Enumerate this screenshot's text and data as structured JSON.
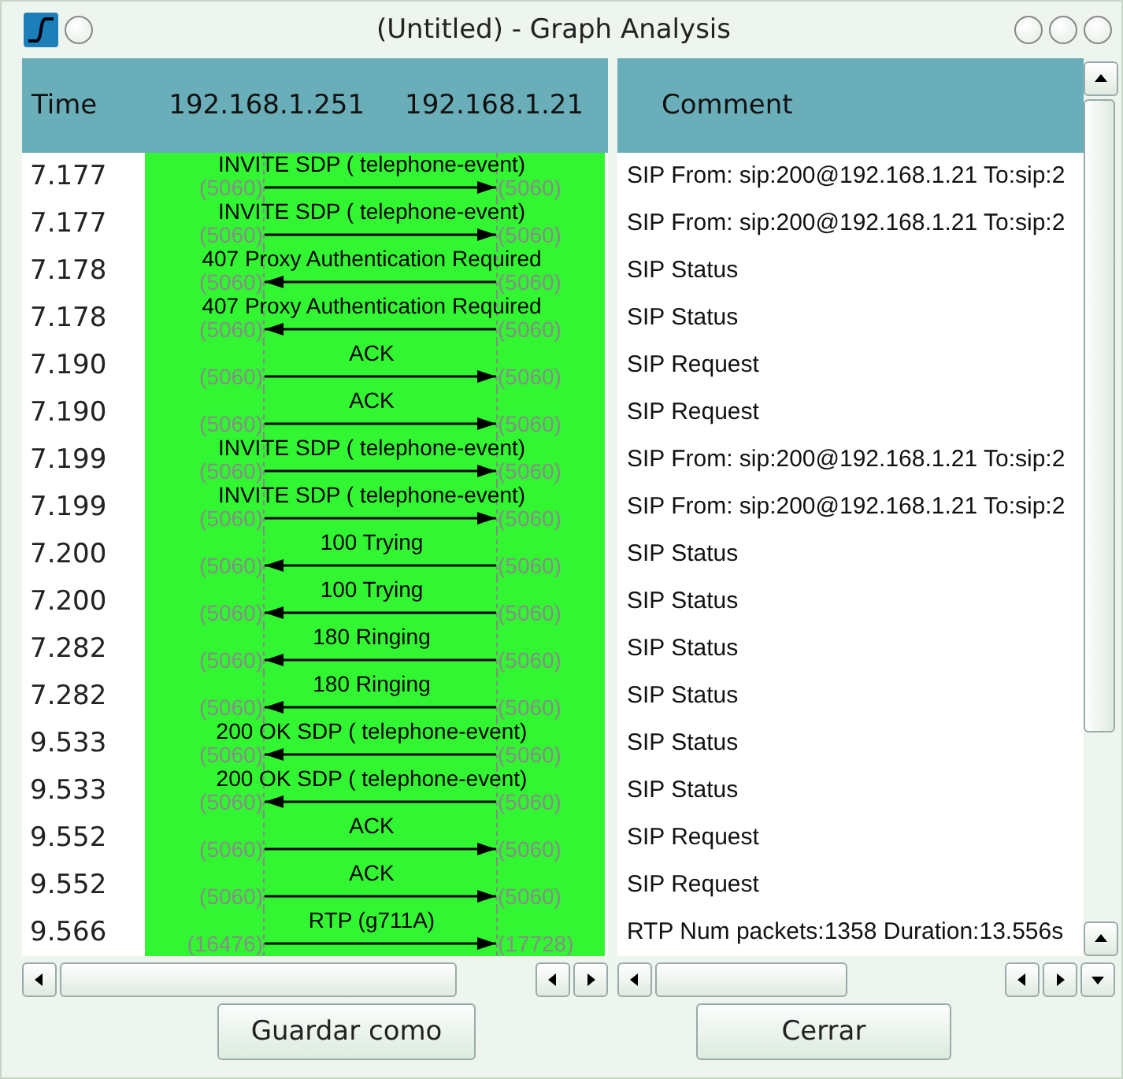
{
  "window": {
    "title": "(Untitled) - Graph Analysis"
  },
  "header": {
    "time": "Time",
    "hosts": [
      "192.168.1.251",
      "192.168.1.21"
    ],
    "comment": "Comment"
  },
  "rows": [
    {
      "time": "7.177",
      "label": "INVITE SDP ( telephone-event)",
      "kind": "rightward",
      "src_port": "(5060)",
      "dst_port": "(5060)",
      "comment": "SIP From: sip:200@192.168.1.21 To:sip:2"
    },
    {
      "time": "7.177",
      "label": "INVITE SDP ( telephone-event)",
      "kind": "rightward",
      "src_port": "(5060)",
      "dst_port": "(5060)",
      "comment": "SIP From: sip:200@192.168.1.21 To:sip:2"
    },
    {
      "time": "7.178",
      "label": "407 Proxy Authentication Required",
      "kind": "leftward",
      "src_port": "(5060)",
      "dst_port": "(5060)",
      "comment": "SIP Status"
    },
    {
      "time": "7.178",
      "label": "407 Proxy Authentication Required",
      "kind": "leftward",
      "src_port": "(5060)",
      "dst_port": "(5060)",
      "comment": "SIP Status"
    },
    {
      "time": "7.190",
      "label": "ACK",
      "kind": "rightward",
      "src_port": "(5060)",
      "dst_port": "(5060)",
      "comment": "SIP Request"
    },
    {
      "time": "7.190",
      "label": "ACK",
      "kind": "rightward",
      "src_port": "(5060)",
      "dst_port": "(5060)",
      "comment": "SIP Request"
    },
    {
      "time": "7.199",
      "label": "INVITE SDP ( telephone-event)",
      "kind": "rightward",
      "src_port": "(5060)",
      "dst_port": "(5060)",
      "comment": "SIP From: sip:200@192.168.1.21 To:sip:2"
    },
    {
      "time": "7.199",
      "label": "INVITE SDP ( telephone-event)",
      "kind": "rightward",
      "src_port": "(5060)",
      "dst_port": "(5060)",
      "comment": "SIP From: sip:200@192.168.1.21 To:sip:2"
    },
    {
      "time": "7.200",
      "label": "100 Trying",
      "kind": "leftward",
      "src_port": "(5060)",
      "dst_port": "(5060)",
      "comment": "SIP Status"
    },
    {
      "time": "7.200",
      "label": "100 Trying",
      "kind": "leftward",
      "src_port": "(5060)",
      "dst_port": "(5060)",
      "comment": "SIP Status"
    },
    {
      "time": "7.282",
      "label": "180 Ringing",
      "kind": "leftward",
      "src_port": "(5060)",
      "dst_port": "(5060)",
      "comment": "SIP Status"
    },
    {
      "time": "7.282",
      "label": "180 Ringing",
      "kind": "leftward",
      "src_port": "(5060)",
      "dst_port": "(5060)",
      "comment": "SIP Status"
    },
    {
      "time": "9.533",
      "label": "200 OK SDP ( telephone-event)",
      "kind": "leftward",
      "src_port": "(5060)",
      "dst_port": "(5060)",
      "comment": "SIP Status"
    },
    {
      "time": "9.533",
      "label": "200 OK SDP ( telephone-event)",
      "kind": "leftward",
      "src_port": "(5060)",
      "dst_port": "(5060)",
      "comment": "SIP Status"
    },
    {
      "time": "9.552",
      "label": "ACK",
      "kind": "rightward",
      "src_port": "(5060)",
      "dst_port": "(5060)",
      "comment": "SIP Request"
    },
    {
      "time": "9.552",
      "label": "ACK",
      "kind": "rightward",
      "src_port": "(5060)",
      "dst_port": "(5060)",
      "comment": "SIP Request"
    },
    {
      "time": "9.566",
      "label": "RTP (g711A)",
      "kind": "rightward",
      "src_port": "(16476)",
      "dst_port": "(17728)",
      "comment": "RTP Num packets:1358  Duration:13.556s"
    }
  ],
  "buttons": [
    "Guardar como",
    "Cerrar"
  ]
}
